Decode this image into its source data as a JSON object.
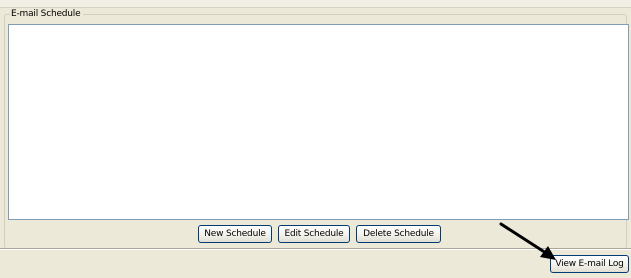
{
  "group": {
    "title": "E-mail Schedule"
  },
  "buttons": {
    "new_schedule": "New Schedule",
    "edit_schedule": "Edit Schedule",
    "delete_schedule": "Delete Schedule",
    "view_email_log": "View E-mail Log"
  },
  "annotation": {
    "arrow_color": "#000000",
    "arrow_icon": "arrow-pointer-icon"
  }
}
